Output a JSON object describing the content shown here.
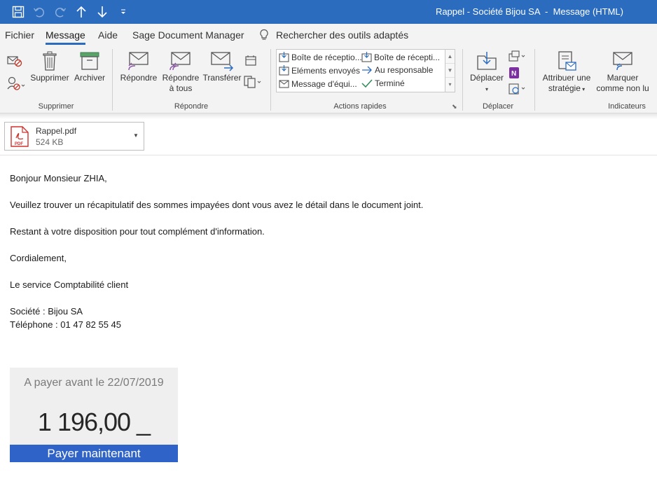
{
  "window": {
    "title": "Rappel - Société Bijou SA  -  Message (HTML)"
  },
  "tabs": [
    {
      "label": "Fichier"
    },
    {
      "label": "Message"
    },
    {
      "label": "Aide"
    },
    {
      "label": "Sage Document Manager"
    },
    {
      "label": "Rechercher des outils adaptés"
    }
  ],
  "ribbon": {
    "delete_group": {
      "label": "Supprimer",
      "delete_label": "Supprimer",
      "archive_label": "Archiver"
    },
    "respond_group": {
      "label": "Répondre",
      "reply_label": "Répondre",
      "reply_all_line1": "Répondre",
      "reply_all_line2": "à tous",
      "forward_label": "Transférer"
    },
    "quick_steps": {
      "label": "Actions rapides",
      "items": [
        "Boîte de réceptio...",
        "Boîte de récepti...",
        "Eléments envoyés",
        "Au responsable",
        "Message d'équi...",
        "Terminé"
      ]
    },
    "move_group": {
      "label": "Déplacer",
      "move_label": "Déplacer"
    },
    "tags_group": {
      "label": "Indicateurs",
      "policy_line1": "Attribuer une",
      "policy_line2": "stratégie",
      "mark_line1": "Marquer",
      "mark_line2": "comme non lu"
    }
  },
  "attachment": {
    "name": "Rappel.pdf",
    "size": "524 KB",
    "icon": "pdf-icon"
  },
  "email_body": {
    "greeting": "Bonjour Monsieur ZHIA,",
    "line1": "Veuillez trouver un récapitulatif des sommes impayées dont vous avez le détail dans le document joint.",
    "line2": "Restant à votre disposition pour tout complément d'information.",
    "closing": "Cordialement,",
    "signature": "Le service Comptabilité client",
    "company": "Société : Bijou SA",
    "phone": "Téléphone : 01 47 82 55 45"
  },
  "payment_card": {
    "due_label": "A payer avant le 22/07/2019",
    "amount": "1 196,00 _",
    "pay_button": "Payer maintenant"
  },
  "colors": {
    "title_bar": "#2b6cbf",
    "pay_button": "#2f63c8",
    "ribbon_bg": "#f3f3f3"
  }
}
